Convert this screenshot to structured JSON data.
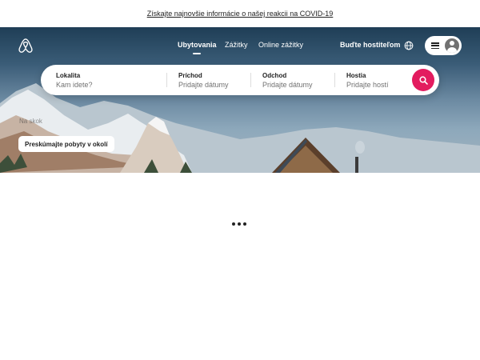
{
  "banner": {
    "text": "Získajte najnovšie informácie o našej reakcii na COVID-19"
  },
  "nav": {
    "tabs": [
      {
        "label": "Ubytovania",
        "active": true
      },
      {
        "label": "Zážitky",
        "active": false
      },
      {
        "label": "Online zážitky",
        "active": false
      }
    ],
    "host_link": "Buďte hostiteľom"
  },
  "search": {
    "fields": [
      {
        "label": "Lokalita",
        "placeholder": "Kam idete?"
      },
      {
        "label": "Príchod",
        "placeholder": "Pridajte dátumy"
      },
      {
        "label": "Odchod",
        "placeholder": "Pridajte dátumy"
      },
      {
        "label": "Hostia",
        "placeholder": "Pridajte hostí"
      }
    ]
  },
  "hero": {
    "faded_text": "Na skok",
    "explore_button": "Preskúmajte pobyty v okolí"
  },
  "colors": {
    "brand": "#e31c5f",
    "brand_logo": "#ffffff",
    "text": "#222222",
    "muted": "#717171"
  },
  "icons": [
    "airbnb-logo-icon",
    "globe-icon",
    "menu-icon",
    "user-avatar-icon",
    "search-icon",
    "loading-dots-icon"
  ]
}
